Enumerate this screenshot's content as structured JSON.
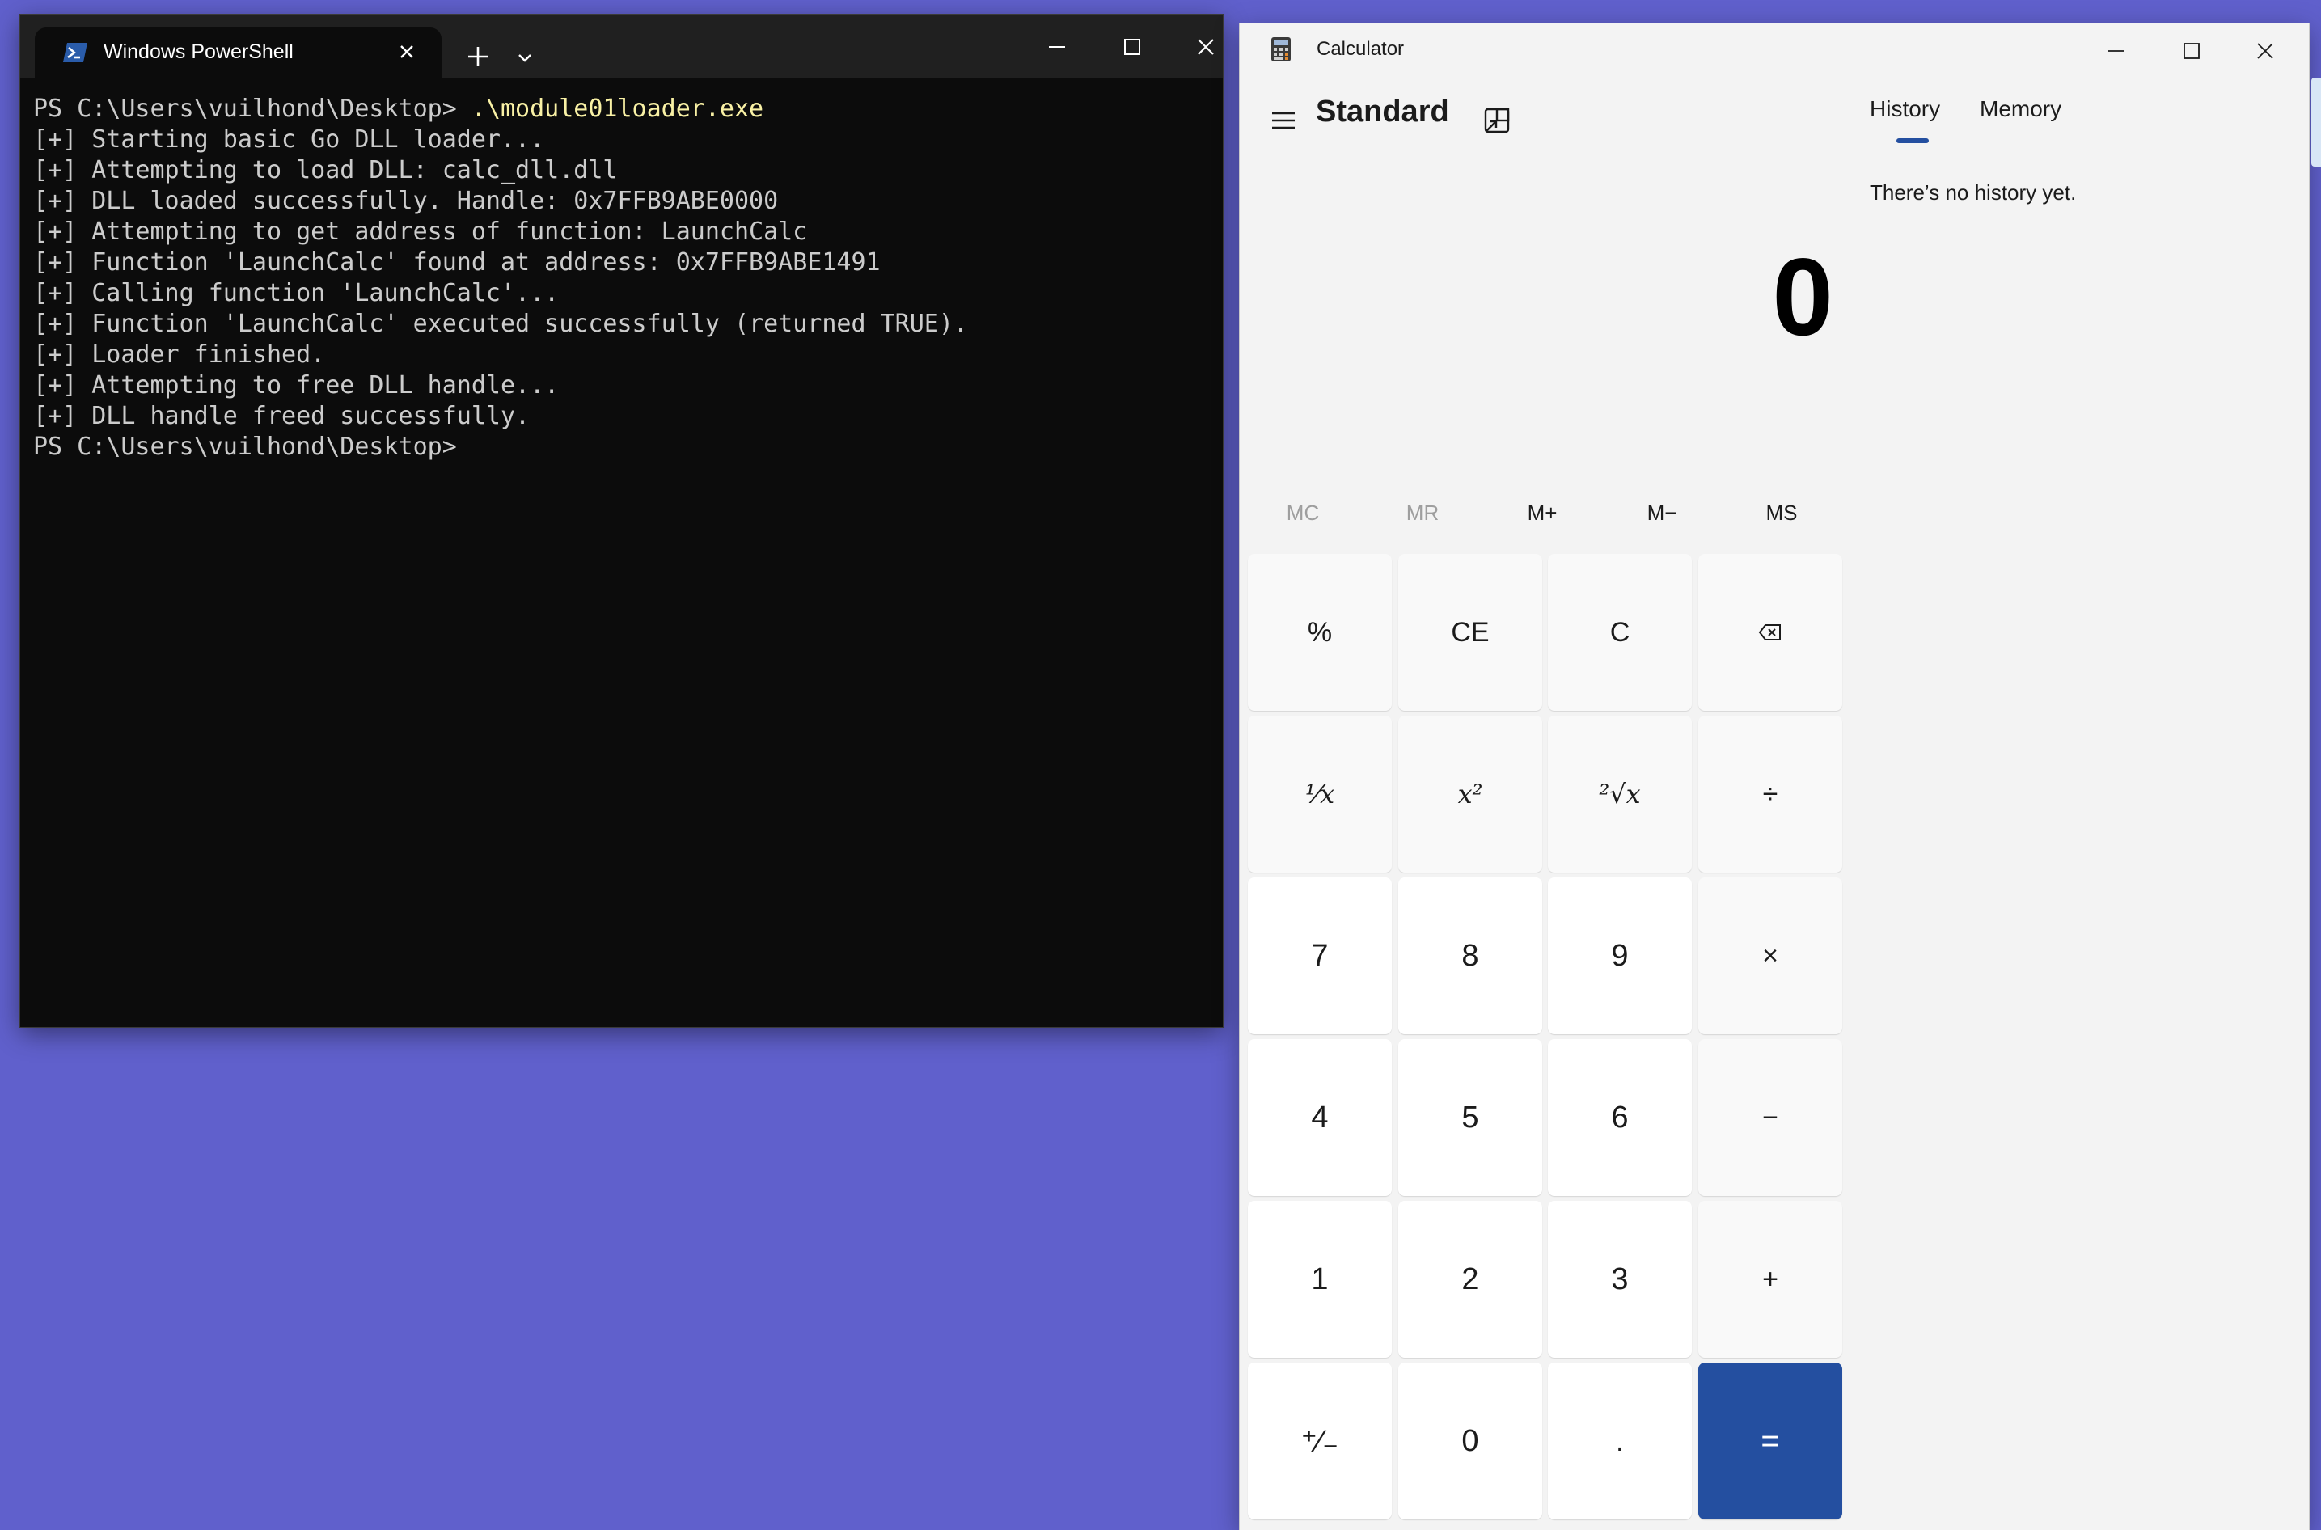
{
  "terminal": {
    "tab_title": "Windows PowerShell",
    "lines": [
      {
        "prompt": "PS C:\\Users\\vuilhond\\Desktop> ",
        "command": ".\\module01loader.exe"
      },
      {
        "text": "[+] Starting basic Go DLL loader..."
      },
      {
        "text": "[+] Attempting to load DLL: calc_dll.dll"
      },
      {
        "text": "[+] DLL loaded successfully. Handle: 0x7FFB9ABE0000"
      },
      {
        "text": "[+] Attempting to get address of function: LaunchCalc"
      },
      {
        "text": "[+] Function 'LaunchCalc' found at address: 0x7FFB9ABE1491"
      },
      {
        "text": "[+] Calling function 'LaunchCalc'..."
      },
      {
        "text": "[+] Function 'LaunchCalc' executed successfully (returned TRUE)."
      },
      {
        "text": "[+] Loader finished."
      },
      {
        "text": "[+] Attempting to free DLL handle..."
      },
      {
        "text": "[+] DLL handle freed successfully."
      },
      {
        "prompt": "PS C:\\Users\\vuilhond\\Desktop>",
        "command": ""
      }
    ]
  },
  "calculator": {
    "window_title": "Calculator",
    "mode": "Standard",
    "display": "0",
    "memory_buttons": [
      {
        "label": "MC",
        "enabled": false
      },
      {
        "label": "MR",
        "enabled": false
      },
      {
        "label": "M+",
        "enabled": true
      },
      {
        "label": "M−",
        "enabled": true
      },
      {
        "label": "MS",
        "enabled": true
      }
    ],
    "keys": {
      "percent": "%",
      "ce": "CE",
      "clear": "C",
      "reciprocal": "¹⁄x",
      "square": "x²",
      "sqrt": "²√x",
      "divide": "÷",
      "seven": "7",
      "eight": "8",
      "nine": "9",
      "multiply": "×",
      "four": "4",
      "five": "5",
      "six": "6",
      "minus": "−",
      "one": "1",
      "two": "2",
      "three": "3",
      "plus": "+",
      "negate": "⁺⁄₋",
      "zero": "0",
      "decimal": ".",
      "equals": "="
    },
    "side_tabs": {
      "history": "History",
      "memory": "Memory"
    },
    "history_empty": "There’s no history yet.",
    "accent_color": "#244fa0"
  },
  "colors": {
    "desktop": "#6060cc",
    "terminal_bg": "#0c0c0c",
    "terminal_text": "#cccccc",
    "terminal_command": "#f9f1a5"
  }
}
